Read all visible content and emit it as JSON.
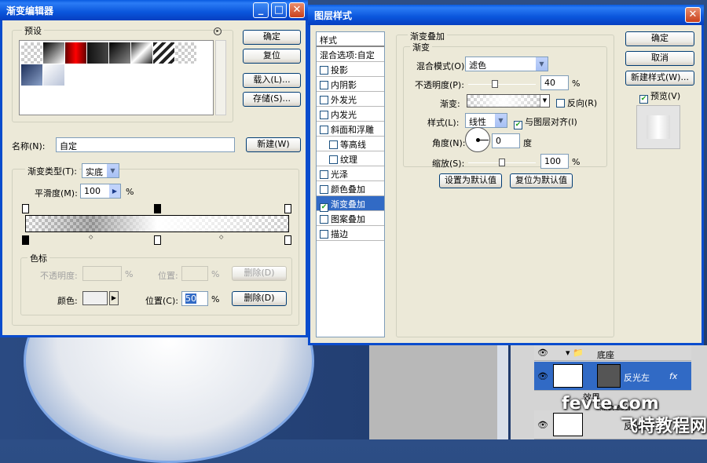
{
  "gradient_editor": {
    "title": "渐变编辑器",
    "presets_label": "预设",
    "ok": "确定",
    "reset": "复位",
    "load": "载入(L)...",
    "save": "存储(S)...",
    "name_label": "名称(N):",
    "name_value": "自定",
    "new_button": "新建(W)",
    "type_label": "渐变类型(T):",
    "type_value": "实底",
    "smooth_label": "平滑度(M):",
    "smooth_value": "100",
    "smooth_unit": "%",
    "stops_label": "色标",
    "opacity_label": "不透明度:",
    "opacity_unit": "%",
    "position_label_1": "位置:",
    "position_unit_1": "%",
    "delete_1": "删除(D)",
    "color_label": "颜色:",
    "position_label_2": "位置(C):",
    "position_value": "50",
    "position_unit_2": "%",
    "delete_2": "删除(D)"
  },
  "layer_style": {
    "title": "图层样式",
    "sidebar": [
      {
        "label": "样式",
        "checkbox": false,
        "checked": false
      },
      {
        "label": "混合选项:自定",
        "checkbox": false,
        "checked": false
      },
      {
        "label": "投影",
        "checkbox": true,
        "checked": false
      },
      {
        "label": "内阴影",
        "checkbox": true,
        "checked": false
      },
      {
        "label": "外发光",
        "checkbox": true,
        "checked": false
      },
      {
        "label": "内发光",
        "checkbox": true,
        "checked": false
      },
      {
        "label": "斜面和浮雕",
        "checkbox": true,
        "checked": false
      },
      {
        "label": "等高线",
        "checkbox": true,
        "checked": false
      },
      {
        "label": "纹理",
        "checkbox": true,
        "checked": false
      },
      {
        "label": "光泽",
        "checkbox": true,
        "checked": false
      },
      {
        "label": "颜色叠加",
        "checkbox": true,
        "checked": false
      },
      {
        "label": "渐变叠加",
        "checkbox": true,
        "checked": true
      },
      {
        "label": "图案叠加",
        "checkbox": true,
        "checked": false
      },
      {
        "label": "描边",
        "checkbox": true,
        "checked": false
      }
    ],
    "section_title": "渐变叠加",
    "subsection_title": "渐变",
    "blend_label": "混合模式(O):",
    "blend_value": "滤色",
    "opacity_label": "不透明度(P):",
    "opacity_value": "40",
    "opacity_unit": "%",
    "gradient_label": "渐变:",
    "reverse_label": "反向(R)",
    "style_label": "样式(L):",
    "style_value": "线性",
    "align_label": "与图层对齐(I)",
    "angle_label": "角度(N):",
    "angle_value": "0",
    "angle_unit": "度",
    "scale_label": "缩放(S):",
    "scale_value": "100",
    "scale_unit": "%",
    "set_default": "设置为默认值",
    "reset_default": "复位为默认值",
    "ok": "确定",
    "cancel": "取消",
    "new_style": "新建样式(W)...",
    "preview_label": "预览(V)",
    "opacity_fraction": 0.4,
    "scale_fraction": 0.5
  },
  "layers": {
    "group_name": "底座",
    "layer1": "反光左",
    "effects": "效果",
    "layer2": "反光右",
    "layer_sub": "渐变叠加"
  },
  "watermark": {
    "site": "fevte.com",
    "brand": "飞特教程网"
  }
}
